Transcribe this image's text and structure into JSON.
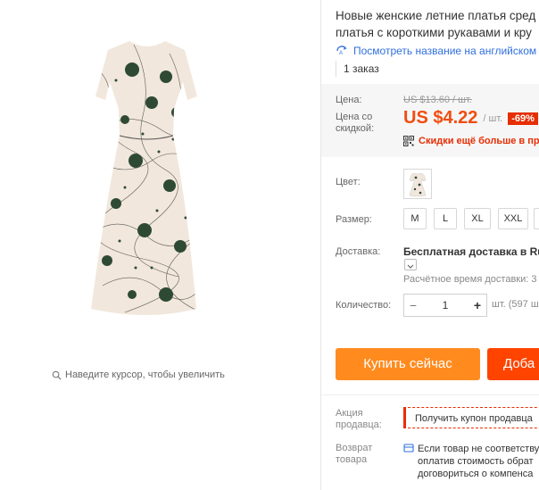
{
  "gallery": {
    "zoom_hint": "Наведите курсор, чтобы увеличить"
  },
  "product": {
    "title_line1": "Новые женские летние платья сред",
    "title_line2": "платья с короткими рукавами и кру",
    "translate_link": "Посмотреть название на английском",
    "orders": "1 заказ"
  },
  "pricing": {
    "price_label": "Цена:",
    "old_price": "US $13.60 / шт.",
    "sale_label_1": "Цена со",
    "sale_label_2": "скидкой:",
    "new_price": "US $4.22",
    "unit": "/ шт.",
    "discount": "-69%",
    "promo": "Скидки ещё больше в при"
  },
  "options": {
    "color_label": "Цвет:",
    "size_label": "Размер:",
    "sizes": [
      "M",
      "L",
      "XL",
      "XXL"
    ],
    "shipping_label": "Доставка:",
    "shipping_value": "Бесплатная доставка в Russ",
    "delivery_time": "Расчётное время доставки: 3",
    "quantity_label": "Количество:",
    "quantity_value": "1",
    "quantity_minus": "−",
    "quantity_plus": "+",
    "stock": "шт. (597 ш"
  },
  "actions": {
    "buy_now": "Купить сейчас",
    "add_to_cart": "Доба"
  },
  "extras": {
    "promo_label_1": "Акция",
    "promo_label_2": "продавца:",
    "coupon": "Получить купон продавца",
    "return_label_1": "Возврат",
    "return_label_2": "товара",
    "return_line1": "Если товар не соответству",
    "return_line2": "оплатив стоимость обрат",
    "return_line3": "договориться о компенса"
  },
  "colors": {
    "accent_orange": "#ff8b1f",
    "cart_red": "#ff4400",
    "price_red": "#f04d10",
    "link_blue": "#2f6fdf",
    "dress_base": "#f2e7dc",
    "dot_green": "#2e4a35"
  }
}
